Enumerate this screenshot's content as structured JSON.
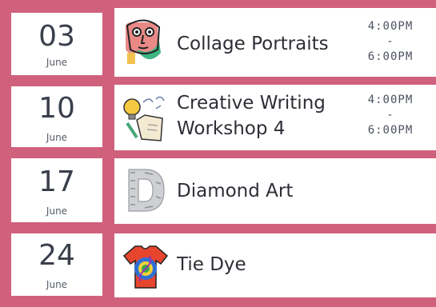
{
  "events": [
    {
      "day": "03",
      "month": "June",
      "title": "Collage Portraits",
      "time_start": "4:00PM",
      "time_sep": "-",
      "time_end": "6:00PM",
      "icon": "collage-face-icon"
    },
    {
      "day": "10",
      "month": "June",
      "title_line1": "Creative Writing",
      "title_line2": "Workshop 4",
      "time_start": "4:00PM",
      "time_sep": "-",
      "time_end": "6:00PM",
      "icon": "lightbulb-scroll-icon"
    },
    {
      "day": "17",
      "month": "June",
      "title": "Diamond Art",
      "icon": "diamond-letter-d-icon"
    },
    {
      "day": "24",
      "month": "June",
      "title": "Tie Dye",
      "icon": "tie-dye-shirt-icon"
    }
  ],
  "colors": {
    "background": "#d0617d",
    "card": "#ffffff",
    "text": "#2d2f36"
  }
}
